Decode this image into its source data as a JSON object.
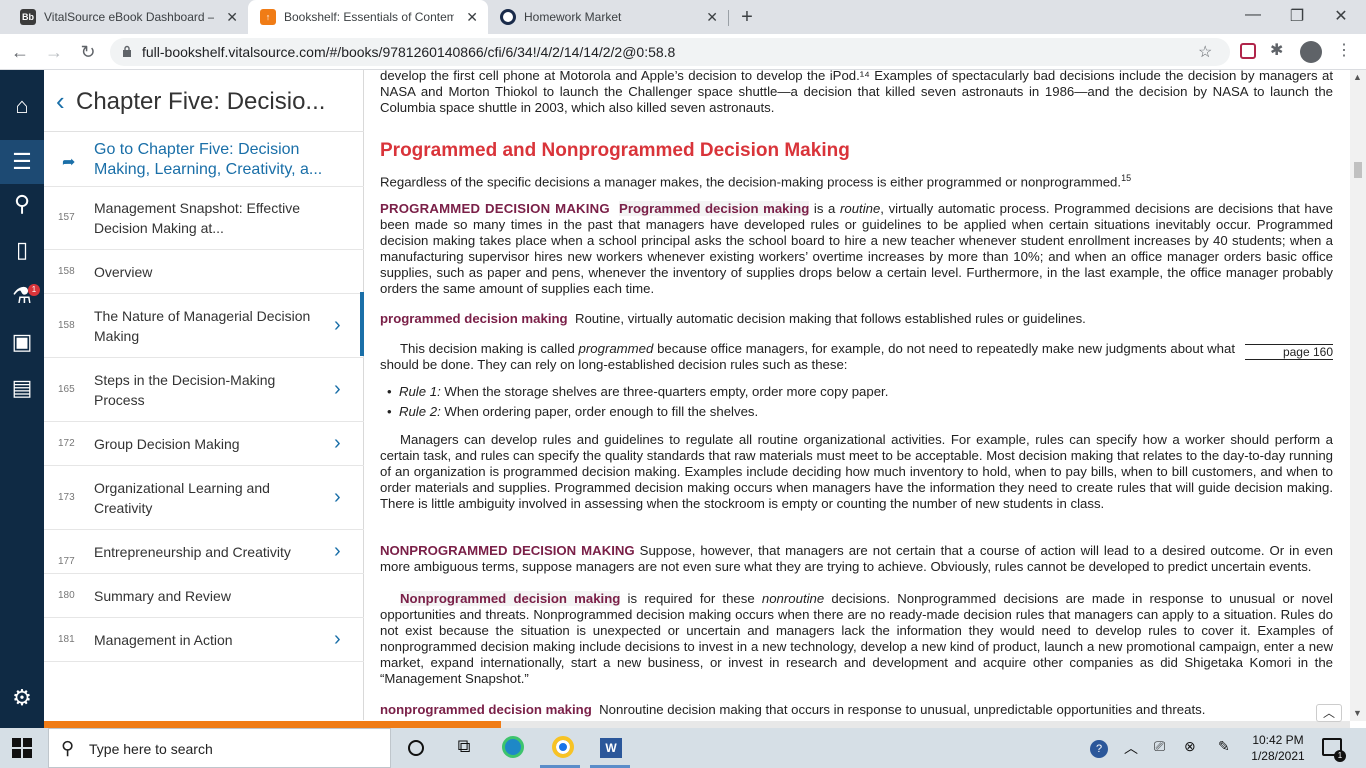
{
  "browser": {
    "tabs": [
      {
        "label": "VitalSource eBook Dashboard – E",
        "fav": "Bb",
        "fav_color": "#3b3b3b"
      },
      {
        "label": "Bookshelf: Essentials of Contemp",
        "fav": "↑",
        "fav_color": "#f07c16"
      },
      {
        "label": "Homework Market",
        "fav": "",
        "fav_color": "#1a2b4a"
      }
    ],
    "url": "full-bookshelf.vitalsource.com/#/books/9781260140866/cfi/6/34!/4/2/14/14/2/2@0:58.8"
  },
  "rail": {
    "badge": "1"
  },
  "toc": {
    "title": "Chapter Five: Decisio...",
    "goto_label": "Go to Chapter Five: Decision Making, Learning, Creativity, a...",
    "items": [
      {
        "page": "157",
        "label": "Management Snapshot: Effective Decision Making at..."
      },
      {
        "page": "158",
        "label": "Overview"
      },
      {
        "page": "158",
        "label": "The Nature of Managerial Decision Making"
      },
      {
        "page": "165",
        "label": "Steps in the Decision-Making Process"
      },
      {
        "page": "172",
        "label": "Group Decision Making"
      },
      {
        "page": "173",
        "label": "Organizational Learning and Creativity"
      },
      {
        "page": "177",
        "label": "Entrepreneurship and Creativity"
      },
      {
        "page": "180",
        "label": "Summary and Review"
      },
      {
        "page": "181",
        "label": "Management in Action"
      }
    ],
    "progress_fraction": 0.35
  },
  "reader": {
    "p0": "develop the first cell phone at Motorola and Apple’s decision to develop the iPod.¹⁴ Examples of spectacularly bad decisions include the decision by managers at NASA and Morton Thiokol to launch the Challenger space shuttle—a decision that killed seven astronauts in 1986—and the decision by NASA to launch the Columbia space shuttle in 2003, which also killed seven astronauts.",
    "heading": "Programmed and Nonprogrammed Decision Making",
    "p1": "Regardless of the specific decisions a manager makes, the decision-making process is either programmed or nonprogrammed.",
    "p1_sup": "15",
    "p2_label": "PROGRAMMED DECISION MAKING",
    "p2_term": "Programmed decision making",
    "p2_a": " is a ",
    "p2_b": "routine",
    "p2_c": ", virtually automatic process. Programmed decisions are decisions that have been made so many times in the past that managers have developed rules or guidelines to be applied when certain situations inevitably occur. Programmed decision making takes place when a school principal asks the school board to hire a new teacher whenever student enrollment increases by 40 students; when a manufacturing supervisor hires new workers whenever existing workers’ overtime increases by more than 10%; and when an office manager orders basic office supplies, such as paper and pens, whenever the inventory of supplies drops below a certain level. Furthermore, in the last example, the office manager probably orders the same amount of supplies each time.",
    "def1_term": "programmed decision making",
    "def1_text": "Routine, virtually automatic decision making that follows established rules or guidelines.",
    "p3_a": "This decision making is called ",
    "p3_b": "programmed",
    "p3_c": " because office managers, for example, do not need to repeatedly make new judgments about what should be done. They can rely on long-established decision rules such as these:",
    "page_marker": "page 160",
    "bullet1_label": "Rule 1:",
    "bullet1_text": " When the storage shelves are three-quarters empty, order more copy paper.",
    "bullet2_label": "Rule 2:",
    "bullet2_text": " When ordering paper, order enough to fill the shelves.",
    "p4": "Managers can develop rules and guidelines to regulate all routine organizational activities. For example, rules can specify how a worker should perform a certain task, and rules can specify the quality standards that raw materials must meet to be acceptable. Most decision making that relates to the day-to-day running of an organization is programmed decision making. Examples include deciding how much inventory to hold, when to pay bills, when to bill customers, and when to order materials and supplies. Programmed decision making occurs when managers have the information they need to create rules that will guide decision making. There is little ambiguity involved in assessing when the stockroom is empty or counting the number of new students in class.",
    "p5_label": "NONPROGRAMMED DECISION MAKING",
    "p5_text": " Suppose, however, that managers are not certain that a course of action will lead to a desired outcome. Or in even more ambiguous terms, suppose managers are not even sure what they are trying to achieve. Obviously, rules cannot be developed to predict uncertain events.",
    "p6_term": "Nonprogrammed decision making",
    "p6_a": " is required for these ",
    "p6_b": "nonroutine",
    "p6_c": " decisions. Nonprogrammed decisions are made in response to unusual or novel opportunities and threats. Nonprogrammed decision making occurs when there are no ready-made decision rules that managers can apply to a situation. Rules do not exist because the situation is unexpected or uncertain and managers lack the information they would need to develop rules to cover it. Examples of nonprogrammed decision making include decisions to invest in a new technology, develop a new kind of product, launch a new promotional campaign, enter a new market, expand internationally, start a new business, or invest in research and development and acquire other companies as did Shigetaka Komori in the “Management Snapshot.”",
    "def2_term": "nonprogrammed decision making",
    "def2_text": "Nonroutine decision making that occurs in response to unusual, unpredictable opportunities and threats."
  },
  "taskbar": {
    "search_placeholder": "Type here to search",
    "time": "10:42 PM",
    "date": "1/28/2021",
    "notif_badge": "1"
  }
}
